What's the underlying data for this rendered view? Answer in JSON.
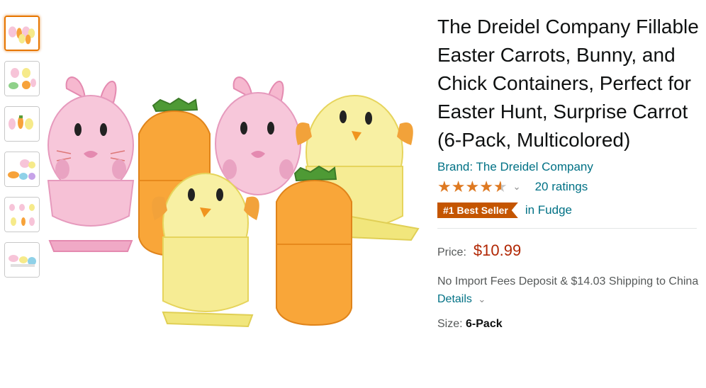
{
  "product": {
    "title": "The Dreidel Company Fillable Easter Carrots, Bunny, and Chick Containers, Perfect for Easter Hunt, Surprise Carrot (6-Pack, Multicolored)",
    "brand": "Brand: The Dreidel Company",
    "rating_stars": 4.5,
    "ratings_count": "20 ratings",
    "best_seller_badge": "#1 Best Seller",
    "best_seller_category": "in Fudge",
    "price_label": "Price:",
    "price": "$10.99",
    "shipping_text": "No Import Fees Deposit & $14.03 Shipping to China",
    "details_link": "Details",
    "size_label": "Size:",
    "size_value": "6-Pack"
  },
  "colors": {
    "link": "#007185",
    "price": "#b12704",
    "badge": "#c45500",
    "star": "#de7921",
    "selected_thumb_border": "#e77600"
  },
  "thumbnails": [
    {
      "name": "thumb-1",
      "selected": true
    },
    {
      "name": "thumb-2",
      "selected": false
    },
    {
      "name": "thumb-3",
      "selected": false
    },
    {
      "name": "thumb-4",
      "selected": false
    },
    {
      "name": "thumb-5",
      "selected": false
    },
    {
      "name": "thumb-6",
      "selected": false
    }
  ]
}
